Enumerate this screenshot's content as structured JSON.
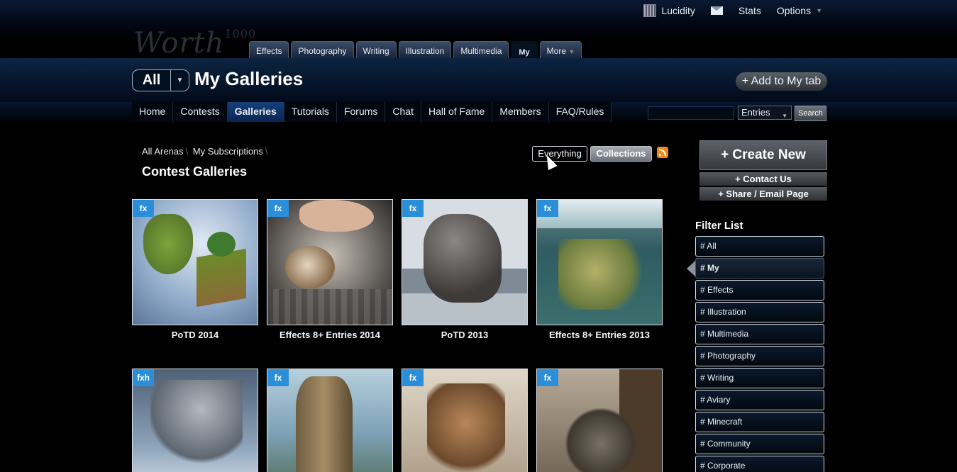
{
  "top_nav": {
    "user_name": "Lucidity",
    "stats": "Stats",
    "options": "Options"
  },
  "logo": {
    "text": "Worth",
    "superscript": "1000"
  },
  "tabs": [
    "Effects",
    "Photography",
    "Writing",
    "Illustration",
    "Multimedia",
    "My",
    "More"
  ],
  "header": {
    "scope_label": "All",
    "title": "My Galleries",
    "add_tab_label": "+ Add to My tab"
  },
  "main_nav": {
    "items": [
      "Home",
      "Contests",
      "Galleries",
      "Tutorials",
      "Forums",
      "Chat",
      "Hall of Fame",
      "Members",
      "FAQ/Rules"
    ],
    "active": "Galleries"
  },
  "search": {
    "input_value": "",
    "select_value": "Entries",
    "button_label": "Search"
  },
  "breadcrumb": [
    "All Arenas",
    "My Subscriptions"
  ],
  "content_title": "Contest Galleries",
  "view_toggle": {
    "everything": "Everything",
    "collections": "Collections"
  },
  "galleries": [
    {
      "badge": "fx",
      "title": "PoTD 2014"
    },
    {
      "badge": "fx",
      "title": "Effects 8+ Entries 2014"
    },
    {
      "badge": "fx",
      "title": "PoTD 2013"
    },
    {
      "badge": "fx",
      "title": "Effects 8+ Entries 2013"
    },
    {
      "badge": "fxh",
      "title": ""
    },
    {
      "badge": "fx",
      "title": ""
    },
    {
      "badge": "fx",
      "title": ""
    },
    {
      "badge": "fx",
      "title": ""
    }
  ],
  "sidebar": {
    "create_new": "+ Create New",
    "contact_us": "+ Contact Us",
    "share": "+ Share / Email Page",
    "filter_title": "Filter List",
    "filters": [
      "# All",
      "# My",
      "# Effects",
      "# Illustration",
      "# Multimedia",
      "# Photography",
      "# Writing",
      "# Aviary",
      "# Minecraft",
      "# Community",
      "# Corporate"
    ],
    "active_filter": "# My"
  },
  "colors": {
    "badge": "#2a8fd8",
    "active_nav": "#16407a",
    "rss": "#f08a1c"
  }
}
